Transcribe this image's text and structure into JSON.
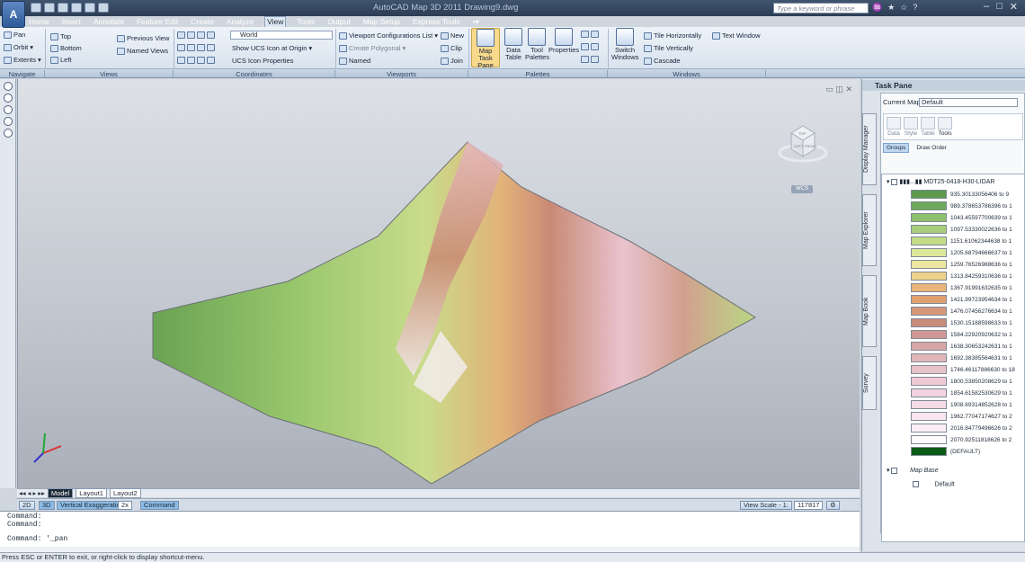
{
  "app": {
    "title": "AutoCAD Map 3D 2011   Drawing9.dwg",
    "search_placeholder": "Type a keyword or phrase"
  },
  "menus": [
    "Home",
    "Insert",
    "Annotate",
    "Feature Edit",
    "Create",
    "Analyze",
    "View",
    "Tools",
    "Output",
    "Map Setup",
    "Express Tools"
  ],
  "active_menu": "View",
  "ribbon": {
    "navigate": {
      "label": "Navigate",
      "items": [
        "Pan",
        "Orbit",
        "Extents"
      ]
    },
    "views": {
      "label": "Views",
      "items": [
        "Top",
        "Bottom",
        "Left"
      ],
      "prev": "Previous View",
      "named": "Named Views"
    },
    "coordinates": {
      "label": "Coordinates",
      "world": "World",
      "ucs": "Show UCS Icon at Origin",
      "ucs_props": "UCS Icon Properties"
    },
    "viewports": {
      "label": "Viewports",
      "config": "Viewport Configurations List",
      "polygonal": "Create Polygonal",
      "named": "Named",
      "new": "New",
      "clip": "Clip",
      "join": "Join"
    },
    "palettes": {
      "label": "Palettes",
      "map": "Map Task Pane",
      "data": "Data Table",
      "tool": "Tool Palettes",
      "props": "Properties"
    },
    "windows": {
      "label": "Windows",
      "switch": "Switch Windows",
      "tile_h": "Tile Horizontally",
      "tile_v": "Tile Vertically",
      "cascade": "Cascade",
      "text": "Text Window"
    }
  },
  "viewport": {
    "cube_top": "TOP",
    "cube_left": "LEFT",
    "cube_front": "FRONT",
    "wcs": "WCS"
  },
  "tabs": [
    "Model",
    "Layout1",
    "Layout2"
  ],
  "status": {
    "v2d": "2D",
    "v3d": "3D",
    "exag_label": "Vertical Exaggeration:",
    "exag_val": "2x",
    "command": "Command",
    "view_scale_label": "View Scale - 1:",
    "view_scale": "117817"
  },
  "command_lines": [
    "Command:",
    "Command:",
    "",
    "Command: '_pan"
  ],
  "bottom_status": "Press ESC or ENTER to exit, or right-click to display shortcut-menu.",
  "task_pane": {
    "title": "Task Pane",
    "current_map_label": "Current Map:",
    "current_map": "Default",
    "tools": [
      "Data",
      "Style",
      "Table",
      "Tools"
    ],
    "groups": "Groups",
    "draw_order": "Draw Order",
    "side_tabs": [
      "Display Manager",
      "Map Explorer",
      "Map Book",
      "Survey"
    ],
    "layer_name": "MDT25-0418-H30-LIDAR",
    "legend": [
      {
        "label": "935.30133056406 to 9",
        "color": "#5d9a4c"
      },
      {
        "label": "989.378653786396 to 1",
        "color": "#6da95a"
      },
      {
        "label": "1043.45597700639 to 1",
        "color": "#8fbf6b"
      },
      {
        "label": "1097.53330022636 to 1",
        "color": "#a9ce7b"
      },
      {
        "label": "1151.61062344638 to 1",
        "color": "#c3dc88"
      },
      {
        "label": "1205.68794666637 to 1",
        "color": "#dbe79a"
      },
      {
        "label": "1259.76526988636 to 1",
        "color": "#ece7a0"
      },
      {
        "label": "1313.84259310636 to 1",
        "color": "#ecd18a"
      },
      {
        "label": "1367.91991632635 to 1",
        "color": "#e9b57a"
      },
      {
        "label": "1421.99723954634 to 1",
        "color": "#dfa06f"
      },
      {
        "label": "1476.07456276634 to 1",
        "color": "#d4977a"
      },
      {
        "label": "1530.15188598633 to 1",
        "color": "#c88b7a"
      },
      {
        "label": "1584.22920920632 to 1",
        "color": "#cf9894"
      },
      {
        "label": "1638.30653242631 to 1",
        "color": "#d7a7a5"
      },
      {
        "label": "1692.38385564631 to 1",
        "color": "#e0b6b8"
      },
      {
        "label": "1746.46117886630 to 18",
        "color": "#e8c2c9"
      },
      {
        "label": "1800.53850208629 to 1",
        "color": "#efcad6"
      },
      {
        "label": "1854.61582530629 to 1",
        "color": "#f2d2df"
      },
      {
        "label": "1908.69314852628 to 1",
        "color": "#f5dbe6"
      },
      {
        "label": "1962.77047174627 to 2",
        "color": "#f8e5ee"
      },
      {
        "label": "2016.84779496626 to 2",
        "color": "#fbeff4"
      },
      {
        "label": "2070.92511818626 to 2",
        "color": "#fefbfd"
      },
      {
        "label": "(DEFAULT)",
        "color": "#0c5a17"
      }
    ],
    "map_base": "Map Base",
    "map_base_item": "Default"
  },
  "colors": {
    "accent": "#2c3e55",
    "viewport_bg": "#c3c8d0"
  }
}
